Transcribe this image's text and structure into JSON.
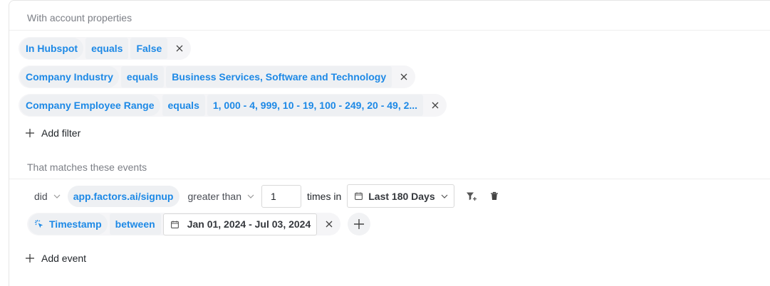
{
  "account_section": {
    "header": "With account properties",
    "filters": [
      {
        "property": "In Hubspot",
        "operator": "equals",
        "value": "False"
      },
      {
        "property": "Company Industry",
        "operator": "equals",
        "value": "Business Services, Software and Technology"
      },
      {
        "property": "Company Employee Range",
        "operator": "equals",
        "value": "1, 000 - 4, 999, 10 - 19, 100 - 249, 20 - 49, 2..."
      }
    ],
    "add_filter_label": "Add filter"
  },
  "events_section": {
    "header": "That matches these events",
    "event": {
      "did_label": "did",
      "event_name": "app.factors.ai/signup",
      "comparison": "greater than",
      "count": "1",
      "times_in_label": "times in",
      "range_label": "Last 180 Days"
    },
    "event_filter": {
      "property": "Timestamp",
      "operator": "between",
      "value": "Jan 01, 2024 - Jul 03, 2024"
    },
    "add_event_label": "Add event"
  },
  "colors": {
    "accent": "#1d89e6",
    "chip_bg": "#eef0f3",
    "muted": "#7c7f86"
  }
}
